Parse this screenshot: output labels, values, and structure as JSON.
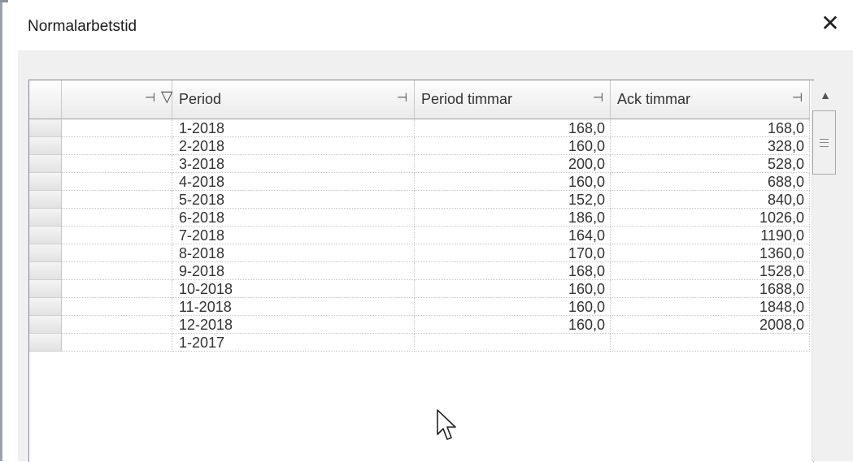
{
  "dialog": {
    "title": "Normalarbetstid",
    "close_glyph": "✕"
  },
  "grid": {
    "columns": [
      {
        "key": "filter",
        "label": ""
      },
      {
        "key": "period",
        "label": "Period"
      },
      {
        "key": "period_timmar",
        "label": "Period timmar"
      },
      {
        "key": "ack_timmar",
        "label": "Ack timmar"
      }
    ],
    "pin_glyph": "⊣",
    "filter_glyph": "▽",
    "rows": [
      {
        "period": "1-2018",
        "period_timmar": "168,0",
        "ack_timmar": "168,0"
      },
      {
        "period": "2-2018",
        "period_timmar": "160,0",
        "ack_timmar": "328,0"
      },
      {
        "period": "3-2018",
        "period_timmar": "200,0",
        "ack_timmar": "528,0"
      },
      {
        "period": "4-2018",
        "period_timmar": "160,0",
        "ack_timmar": "688,0"
      },
      {
        "period": "5-2018",
        "period_timmar": "152,0",
        "ack_timmar": "840,0"
      },
      {
        "period": "6-2018",
        "period_timmar": "186,0",
        "ack_timmar": "1026,0"
      },
      {
        "period": "7-2018",
        "period_timmar": "164,0",
        "ack_timmar": "1190,0"
      },
      {
        "period": "8-2018",
        "period_timmar": "170,0",
        "ack_timmar": "1360,0"
      },
      {
        "period": "9-2018",
        "period_timmar": "168,0",
        "ack_timmar": "1528,0"
      },
      {
        "period": "10-2018",
        "period_timmar": "160,0",
        "ack_timmar": "1688,0"
      },
      {
        "period": "11-2018",
        "period_timmar": "160,0",
        "ack_timmar": "1848,0"
      },
      {
        "period": "12-2018",
        "period_timmar": "160,0",
        "ack_timmar": "2008,0"
      },
      {
        "period": "1-2017",
        "period_timmar": "",
        "ack_timmar": ""
      }
    ]
  },
  "icons": {
    "close": "close-icon",
    "pin": "pin-icon",
    "filter": "filter-icon",
    "scroll_up": "chevron-up-icon",
    "cursor": "mouse-pointer-icon"
  }
}
